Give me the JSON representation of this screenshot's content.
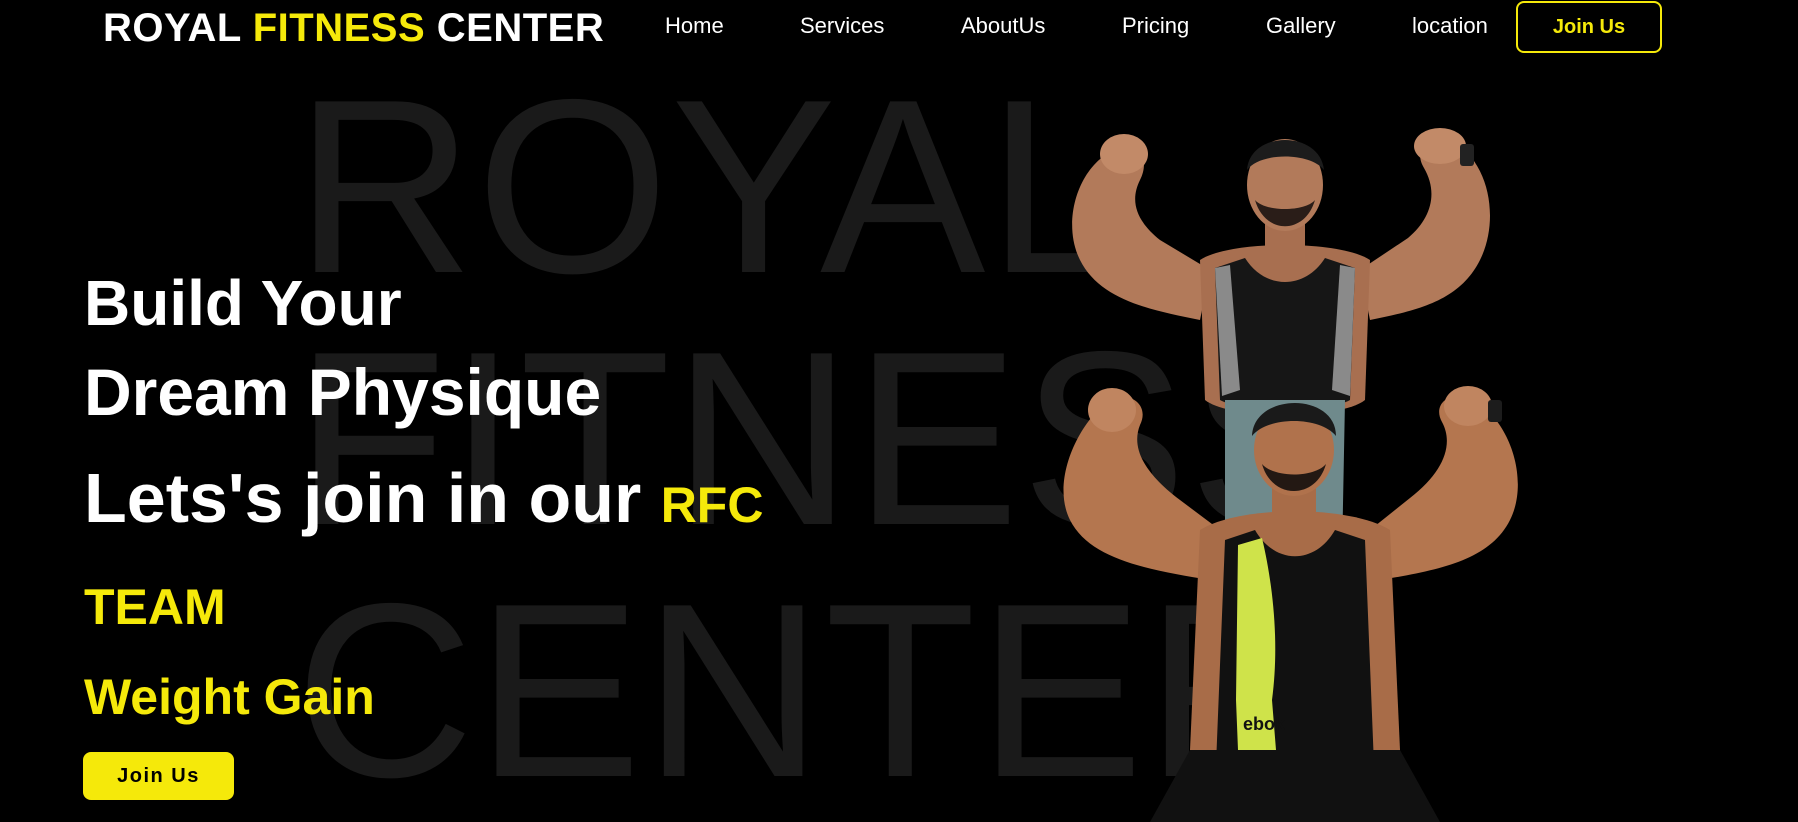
{
  "watermark": {
    "line1": "ROYAL",
    "line2": "FITNESS",
    "line3": "CENTER"
  },
  "brand": {
    "word1": "ROYAL",
    "word2": "FITNESS",
    "word3": "CENTER"
  },
  "nav": {
    "items": [
      "Home",
      "Services",
      "AboutUs",
      "Pricing",
      "Gallery",
      "location"
    ],
    "join_label": "Join Us"
  },
  "hero": {
    "line1": "Build Your",
    "line2": "Dream Physique",
    "line3": "Lets's join in our",
    "rfc": "RFC",
    "line4": "TEAM",
    "line5": "Weight Gain",
    "join_label": "Join Us"
  },
  "photo": {
    "shirt_text": "ebok",
    "description_icon": "bodybuilders-photo"
  },
  "colors": {
    "accent": "#f5e90a",
    "background": "#000000",
    "watermark": "#1a1a1a"
  }
}
